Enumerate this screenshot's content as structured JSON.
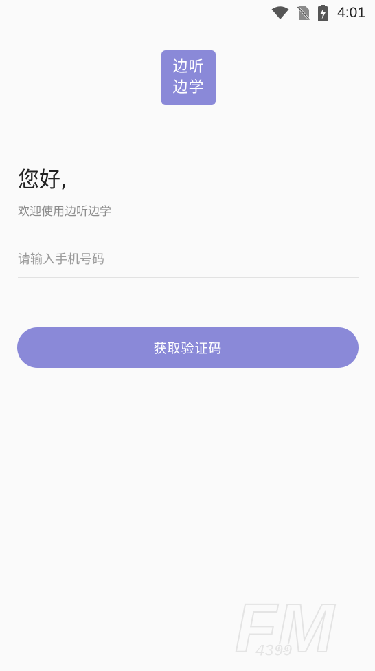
{
  "status_bar": {
    "time": "4:01",
    "icons": [
      "wifi-icon",
      "no-sim-icon",
      "battery-charging-icon"
    ]
  },
  "logo": {
    "line1": "边听",
    "line2": "边学"
  },
  "greeting": "您好,",
  "welcome": "欢迎使用边听边学",
  "phone_input": {
    "placeholder": "请输入手机号码",
    "value": ""
  },
  "code_button": {
    "label": "获取验证码"
  },
  "watermark": {
    "brand": "FM",
    "sub": "4399"
  },
  "colors": {
    "accent": "#8a89d8",
    "background": "#fafafa",
    "text_primary": "#222222",
    "text_secondary": "#8c8c8c"
  }
}
